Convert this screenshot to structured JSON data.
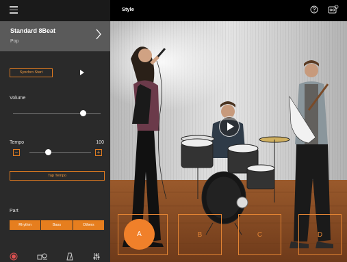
{
  "header": {
    "title": "Style",
    "icons": {
      "menu": "hamburger-icon",
      "help": "question-circle-icon",
      "tuner": "tuner-icon"
    }
  },
  "style": {
    "name": "Standard 8Beat",
    "category": "Pop"
  },
  "transport": {
    "synchro_start_label": "Synchro Start"
  },
  "volume": {
    "label": "Volume",
    "level": 0.8
  },
  "tempo": {
    "label": "Tempo",
    "value": "100",
    "minus": "−",
    "plus": "+",
    "tap_label": "Tap Tempo"
  },
  "part": {
    "label": "Part",
    "buttons": [
      "Rhythm",
      "Bass",
      "Others"
    ]
  },
  "sections": [
    "A",
    "B",
    "C",
    "D"
  ],
  "bottom_nav": [
    "record-icon",
    "style-icon",
    "metronome-icon",
    "settings-icon"
  ],
  "colors": {
    "accent": "#e67e1e",
    "panel": "#2a2a2a",
    "style_card": "#5a5a5a"
  }
}
